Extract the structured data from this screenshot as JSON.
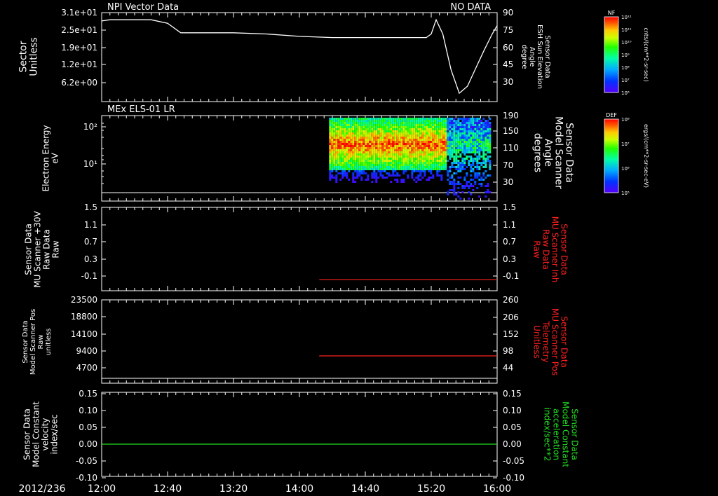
{
  "x_axis": {
    "date_label": "2012/236",
    "ticks": [
      "12:00",
      "12:40",
      "13:20",
      "14:00",
      "14:40",
      "15:20",
      "16:00"
    ],
    "range_minutes": [
      0,
      240
    ]
  },
  "chart_data": [
    {
      "type": "line",
      "panel": "sector",
      "title": "NPI Vector Data",
      "status_text": "NO DATA",
      "ylabel": [
        "Sector",
        "Unitless"
      ],
      "yticks": [
        "3.1e+01",
        "2.5e+01",
        "1.9e+01",
        "1.2e+01",
        "6.2e+00"
      ],
      "ylim": [
        0,
        31
      ],
      "y2label": [
        "Sensor Data",
        "ESH Sun Elevation",
        "Angle",
        "degree"
      ],
      "y2ticks": [
        "90",
        "75",
        "60",
        "45",
        "30"
      ],
      "y2lim": [
        15,
        90
      ],
      "series": [
        {
          "axis": "right",
          "color": "#ffffff",
          "x": [
            "12:00",
            "12:05",
            "12:30",
            "12:40",
            "12:48",
            "13:00",
            "13:20",
            "13:40",
            "14:00",
            "14:20",
            "14:40",
            "15:00",
            "15:10",
            "15:17",
            "15:20",
            "15:23",
            "15:27",
            "15:32",
            "15:37",
            "15:42",
            "15:47",
            "15:52",
            "15:57",
            "16:00"
          ],
          "y": [
            83,
            84,
            84,
            81,
            73,
            73,
            73,
            72,
            70,
            69,
            69,
            69,
            69,
            69,
            72,
            84,
            72,
            42,
            22,
            28,
            43,
            58,
            72,
            79
          ]
        }
      ]
    },
    {
      "type": "heatmap",
      "panel": "els",
      "title": "MEx ELS-01 LR",
      "ylabel": [
        "Electron Energy",
        "eV"
      ],
      "yticks": [
        "10²",
        "10¹"
      ],
      "ylim_log": [
        0.15,
        2.25
      ],
      "y2label": [
        "Sensor Data",
        "Model Scanner",
        "Angle",
        "degrees"
      ],
      "y2ticks": [
        "190",
        "150",
        "110",
        "70",
        "30"
      ],
      "y2lim": [
        0,
        190
      ],
      "data_start": "14:18",
      "data_end": "15:56",
      "colorbar": {
        "label": "DEF",
        "unit": "ergs/(cm**2-sr-sec-eV)",
        "tick_top": "10⁸",
        "tick_mid": "10⁷",
        "tick_mid2": "10⁶",
        "tick_bottom": "10⁵"
      }
    },
    {
      "type": "line",
      "panel": "mu_raw",
      "ylabel": [
        "Sensor Data",
        "MU Scanner +30V",
        "Raw Data",
        "Raw"
      ],
      "yticks": [
        "1.5",
        "1.1",
        "0.7",
        "0.3",
        "-0.1"
      ],
      "ylim": [
        -0.3,
        1.5
      ],
      "y2label": [
        "Sensor Data",
        "MU Scanner Inh",
        "Raw Data",
        "Raw"
      ],
      "y2ticks": [
        "1.5",
        "1.1",
        "0.7",
        "0.3",
        "-0.1"
      ],
      "y2lim": [
        -0.3,
        1.5
      ],
      "series": [
        {
          "axis": "right",
          "color": "#ff2020",
          "x": [
            "14:12",
            "16:00"
          ],
          "y": [
            0.0,
            0.0
          ]
        }
      ]
    },
    {
      "type": "line",
      "panel": "scanner_pos",
      "ylabel": [
        "Sensor Data",
        "Model Scanner Pos",
        "Raw",
        "unitless"
      ],
      "yticks": [
        "23500",
        "18800",
        "14100",
        "9400",
        "4700"
      ],
      "ylim": [
        0,
        23500
      ],
      "y2label": [
        "Sensor Data",
        "MU Scanner Pos",
        "Telemetry",
        "Unitless"
      ],
      "y2ticks": [
        "260",
        "206",
        "152",
        "98",
        "44"
      ],
      "y2lim": [
        0,
        260
      ],
      "series": [
        {
          "axis": "right",
          "color": "#ff2020",
          "x": [
            "14:12",
            "16:00"
          ],
          "y": [
            88,
            88
          ]
        }
      ]
    },
    {
      "type": "line",
      "panel": "velocity",
      "ylabel": [
        "Sensor Data",
        "Model Constant",
        "velocity",
        "index/sec"
      ],
      "yticks": [
        "0.15",
        "0.10",
        "0.05",
        "0.00",
        "-0.05",
        "-0.10"
      ],
      "ylim": [
        -0.1,
        0.15
      ],
      "y2label": [
        "Sensor Data",
        "Model Constant",
        "acceleration",
        "index/sec**2"
      ],
      "y2ticks": [
        "0.15",
        "0.10",
        "0.05",
        "0.00",
        "-0.05",
        "-0.10"
      ],
      "y2lim": [
        -0.1,
        0.15
      ],
      "series": [
        {
          "axis": "left",
          "color": "#22dd22",
          "x": [
            "12:00",
            "16:00"
          ],
          "y": [
            0.0,
            0.0
          ]
        }
      ]
    }
  ],
  "colorbars": [
    {
      "label": "NF",
      "unit": "cnts/(cm**2-sr-sec)",
      "ticks": [
        "10¹²",
        "10¹¹",
        "10¹⁰",
        "10⁹",
        "10⁸",
        "10⁷",
        "10⁶"
      ]
    },
    {
      "label": "DEF",
      "unit": "ergs/(cm**2-sr-sec-eV)",
      "ticks": [
        "10⁸",
        "10⁷",
        "10⁶",
        "10⁵"
      ]
    }
  ],
  "colors": {
    "background": "#000000",
    "foreground": "#ffffff",
    "secondary_axis_red": "#ff2020",
    "secondary_axis_green": "#22dd22"
  }
}
